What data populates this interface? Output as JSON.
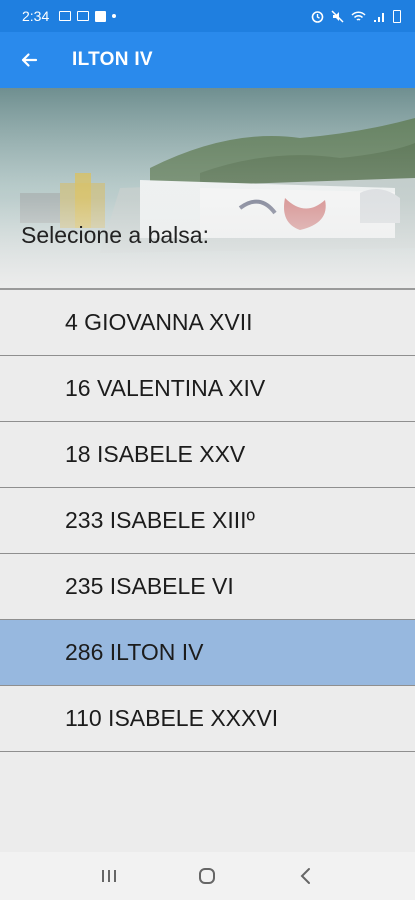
{
  "status_bar": {
    "time": "2:34",
    "left_icons": [
      "image-icon",
      "cast-icon",
      "facebook-icon",
      "dot-icon"
    ],
    "right_icons": [
      "alarm-icon",
      "mute-icon",
      "wifi-icon",
      "signal-icon",
      "battery-icon"
    ]
  },
  "app_bar": {
    "title": "ILTON IV",
    "back_icon": "arrow-left-icon"
  },
  "hero": {
    "prompt": "Selecione a balsa:"
  },
  "list": {
    "items": [
      {
        "label": "4 GIOVANNA XVII"
      },
      {
        "label": "16 VALENTINA XIV"
      },
      {
        "label": "18 ISABELE XXV"
      },
      {
        "label": "233 ISABELE XIIIº"
      },
      {
        "label": "235 ISABELE VI"
      },
      {
        "label": "286 ILTON IV"
      },
      {
        "label": "110 ISABELE XXXVI"
      }
    ],
    "selected_label": "286 ILTON IV"
  },
  "colors": {
    "status_bar": "#1f7fe0",
    "app_bar": "#2a8aec",
    "selected_row": "#97b8df",
    "background": "#ececec"
  },
  "nav_bar": {
    "buttons": [
      "recents-icon",
      "home-icon",
      "back-icon"
    ]
  }
}
